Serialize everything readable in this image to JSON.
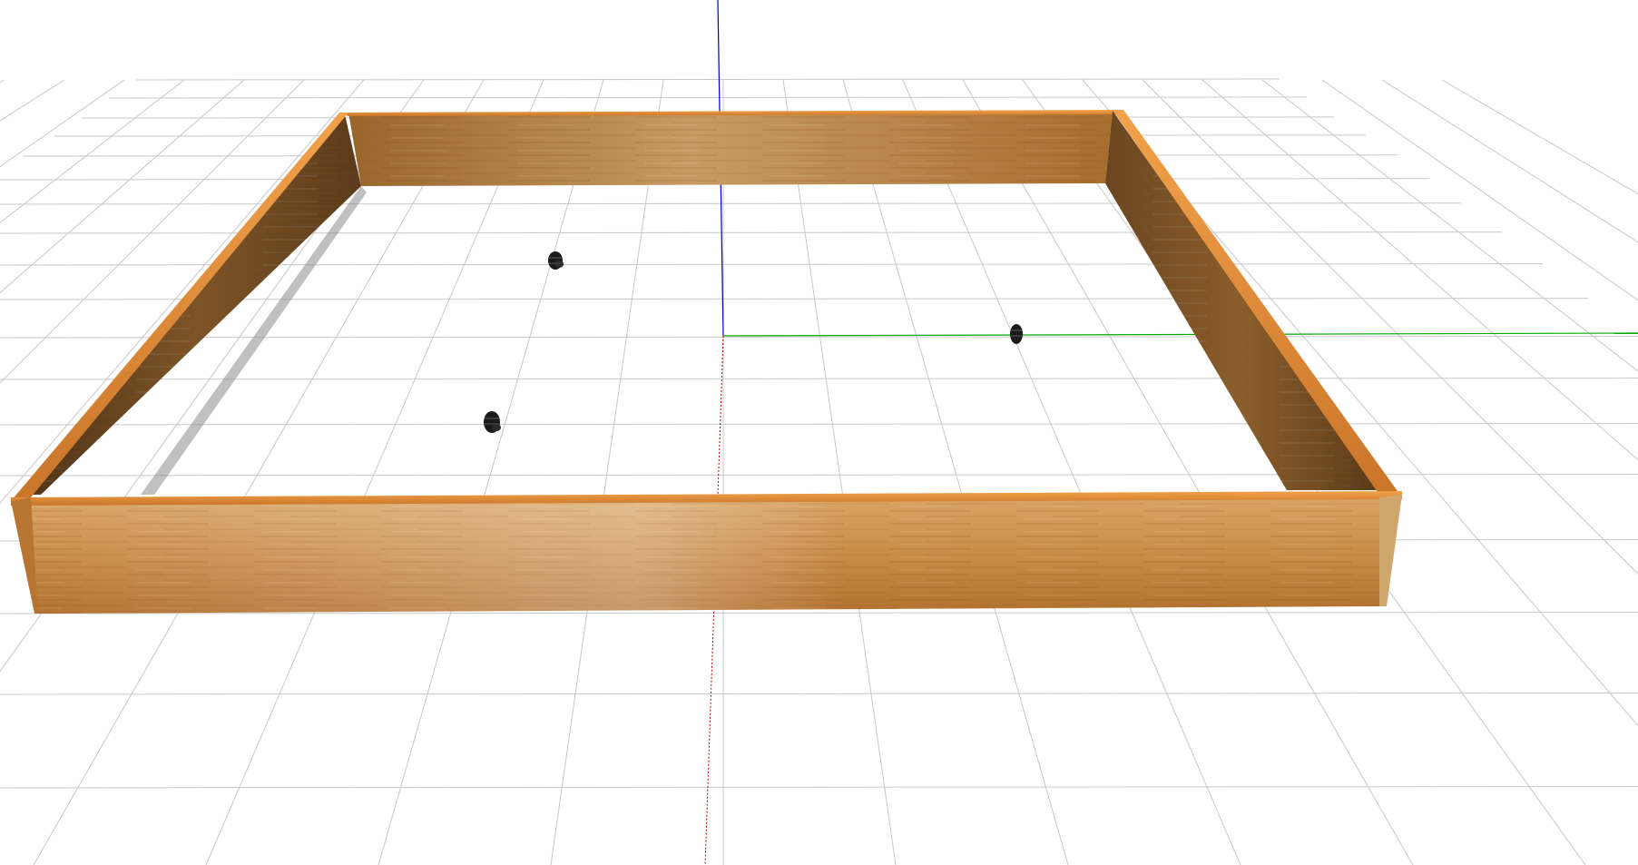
{
  "viewport": {
    "background": "#ffffff",
    "grid_color": "#c8c8c8",
    "axis_colors": {
      "x": "#b40000",
      "y": "#00aa00",
      "z": "#0000cc"
    }
  },
  "arena": {
    "wall_material": "wood",
    "wood_colors": {
      "light": "#d39a55",
      "mid": "#b8752f",
      "dark": "#6e4a22",
      "edge": "#e8903a"
    }
  },
  "robots": [
    {
      "id": "robot-1",
      "color": "#1a1a1a"
    },
    {
      "id": "robot-2",
      "color": "#1a1a1a"
    },
    {
      "id": "robot-3",
      "color": "#1a1a1a"
    }
  ]
}
